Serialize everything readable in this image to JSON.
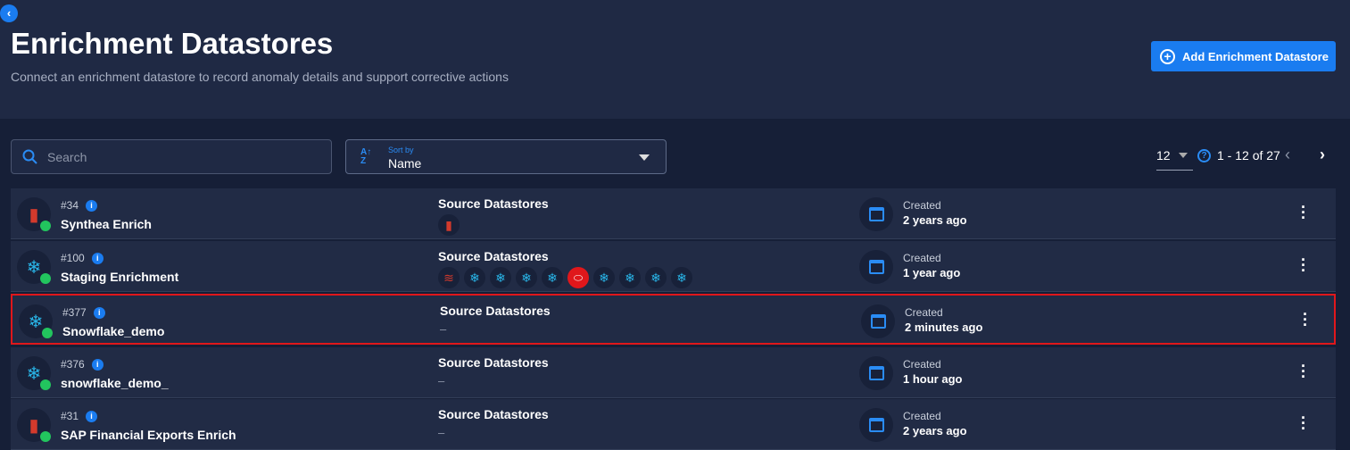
{
  "header": {
    "title": "Enrichment Datastores",
    "subtitle": "Connect an enrichment datastore to record anomaly details and support corrective actions",
    "add_button": "Add Enrichment Datastore"
  },
  "toolbar": {
    "search_placeholder": "Search",
    "sort_label": "Sort by",
    "sort_value": "Name",
    "page_size": "12",
    "range": "1 - 12 of 27"
  },
  "colors": {
    "accent": "#1a7cf0",
    "highlight": "#e0171b",
    "status": "#22c55e"
  },
  "rows": [
    {
      "id": "#34",
      "name": "Synthea Enrich",
      "icon": "redshift-icon",
      "source_label": "Source Datastores",
      "sources": [
        "redshift-icon"
      ],
      "created_label": "Created",
      "created": "2 years ago"
    },
    {
      "id": "#100",
      "name": "Staging Enrichment",
      "icon": "snowflake-icon",
      "source_label": "Source Datastores",
      "sources": [
        "databricks-icon",
        "snowflake-icon",
        "snowflake-icon",
        "snowflake-icon",
        "snowflake-icon",
        "oracle-icon",
        "snowflake-icon",
        "snowflake-icon",
        "snowflake-icon",
        "snowflake-icon"
      ],
      "created_label": "Created",
      "created": "1 year ago"
    },
    {
      "id": "#377",
      "name": "Snowflake_demo",
      "icon": "snowflake-icon",
      "source_label": "Source Datastores",
      "empty": "–",
      "created_label": "Created",
      "created": "2 minutes ago",
      "highlighted": true
    },
    {
      "id": "#376",
      "name": "snowflake_demo_",
      "icon": "snowflake-icon",
      "source_label": "Source Datastores",
      "empty": "–",
      "created_label": "Created",
      "created": "1 hour ago"
    },
    {
      "id": "#31",
      "name": "SAP Financial Exports Enrich",
      "icon": "redshift-icon",
      "source_label": "Source Datastores",
      "empty": "–",
      "created_label": "Created",
      "created": "2 years ago"
    }
  ]
}
